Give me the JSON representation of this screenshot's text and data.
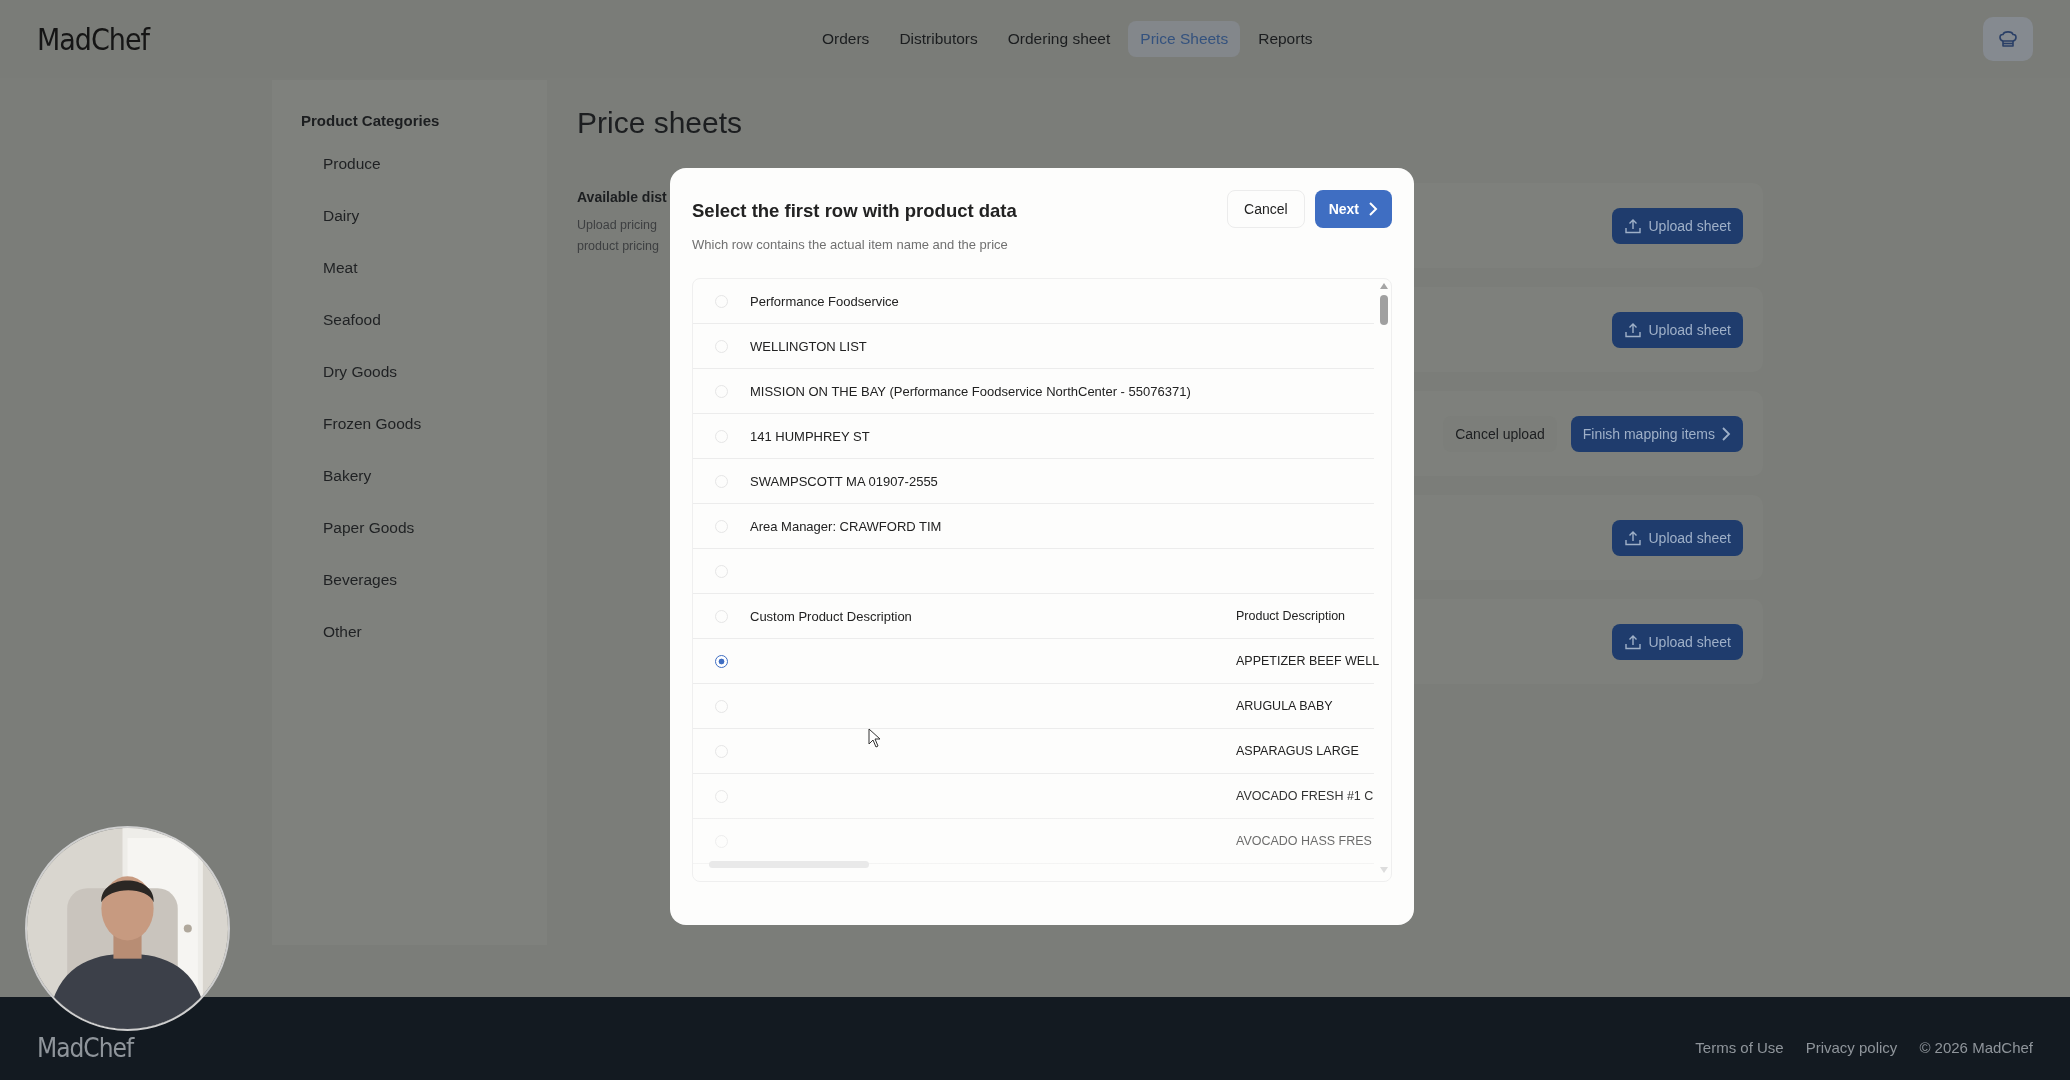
{
  "header": {
    "logo": "MadChef",
    "nav": [
      {
        "label": "Orders",
        "selected": false
      },
      {
        "label": "Distributors",
        "selected": false
      },
      {
        "label": "Ordering sheet",
        "selected": false
      },
      {
        "label": "Price Sheets",
        "selected": true
      },
      {
        "label": "Reports",
        "selected": false
      }
    ]
  },
  "sidebar": {
    "title": "Product Categories",
    "items": [
      "Produce",
      "Dairy",
      "Meat",
      "Seafood",
      "Dry Goods",
      "Frozen Goods",
      "Bakery",
      "Paper Goods",
      "Beverages",
      "Other"
    ]
  },
  "page": {
    "title": "Price sheets",
    "section_title": "Available dist",
    "section_description": [
      "Upload pricing",
      "product pricing"
    ],
    "cards": [
      {
        "kind": "upload",
        "button": "Upload sheet"
      },
      {
        "kind": "upload",
        "button": "Upload sheet"
      },
      {
        "kind": "mapping",
        "cancel": "Cancel upload",
        "button": "Finish mapping items"
      },
      {
        "kind": "upload",
        "button": "Upload sheet"
      },
      {
        "kind": "upload",
        "button": "Upload sheet"
      }
    ]
  },
  "modal": {
    "title": "Select the first row with product data",
    "subtitle": "Which row contains the actual item name and the price",
    "cancel": "Cancel",
    "next": "Next",
    "rows": [
      {
        "column_1": "Performance Foodservice",
        "selected": false
      },
      {
        "column_1": "WELLINGTON LIST",
        "selected": false
      },
      {
        "column_1": "MISSION ON THE BAY (Performance Foodservice NorthCenter - 55076371)",
        "selected": false
      },
      {
        "column_1": "141 HUMPHREY ST",
        "selected": false
      },
      {
        "column_1": "SWAMPSCOTT MA 01907-2555",
        "selected": false
      },
      {
        "column_1": "Area Manager: CRAWFORD TIM",
        "selected": false
      },
      {
        "selected": false
      },
      {
        "column_1": "Custom Product Description",
        "column_2": "Product Description",
        "selected": false
      },
      {
        "column_2": "APPETIZER BEEF WELL",
        "selected": true
      },
      {
        "column_2": "ARUGULA BABY",
        "selected": false
      },
      {
        "column_2": "ASPARAGUS LARGE",
        "selected": false
      },
      {
        "column_2": "AVOCADO FRESH #1 C",
        "selected": false
      },
      {
        "column_2": "AVOCADO HASS FRES",
        "selected": false
      }
    ]
  },
  "footer": {
    "logo": "MadChef",
    "links": [
      "Terms of Use",
      "Privacy policy"
    ],
    "copyright": "© 2026 MadChef"
  }
}
